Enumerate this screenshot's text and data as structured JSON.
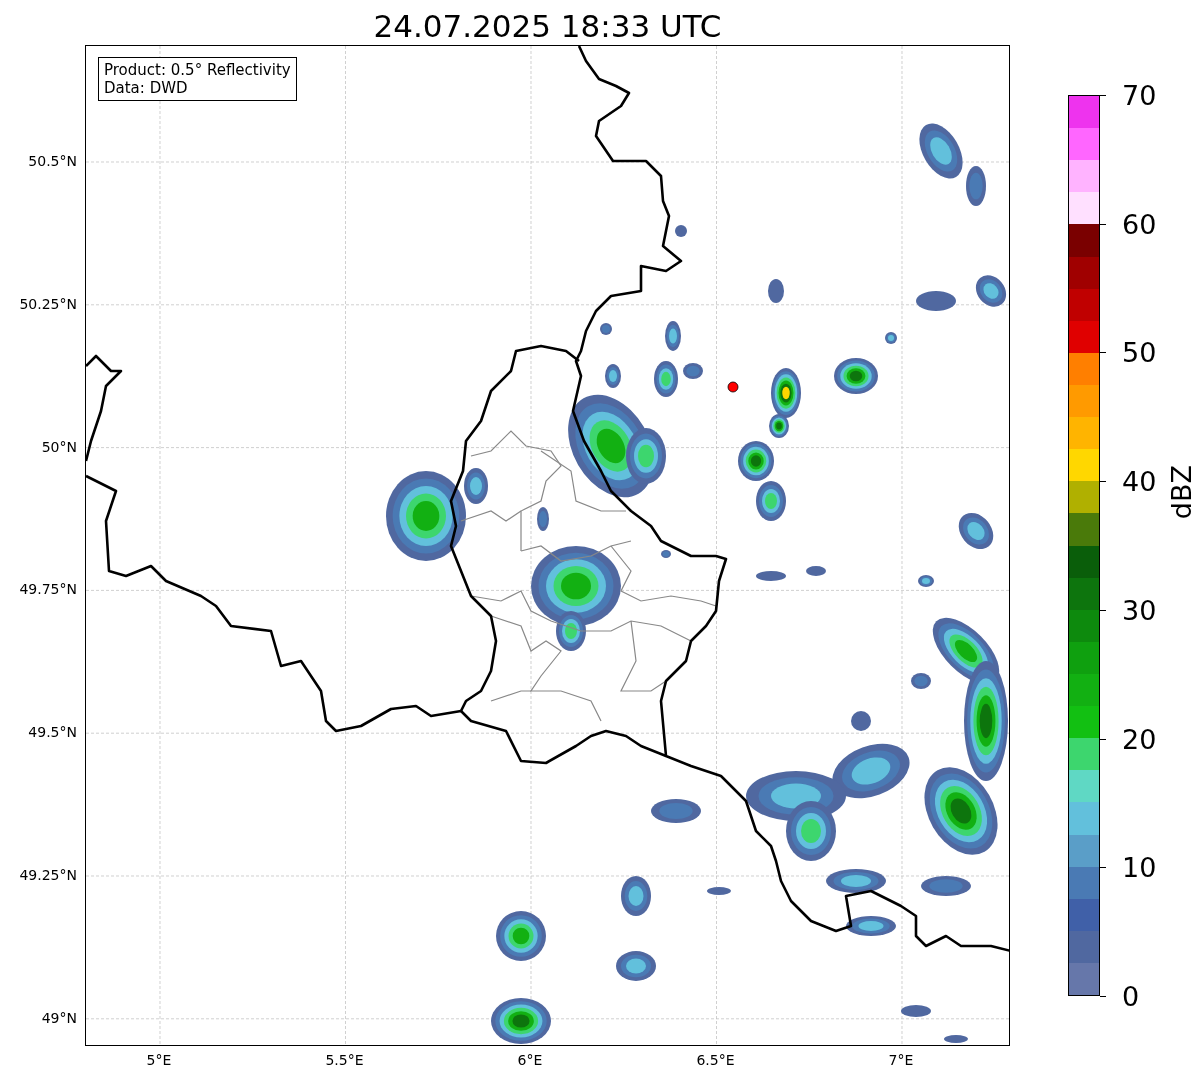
{
  "title": "24.07.2025 18:33 UTC",
  "legend": [
    "Product: 0.5° Reflectivity",
    "Data: DWD"
  ],
  "map": {
    "x_ticks": [
      "5°E",
      "5.5°E",
      "6°E",
      "6.5°E",
      "7°E"
    ],
    "y_ticks": [
      "50.5°N",
      "50.25°N",
      "50°N",
      "49.75°N",
      "49.5°N",
      "49.25°N",
      "49°N"
    ]
  },
  "colorbar": {
    "label": "dBZ",
    "ticks": [
      "70",
      "60",
      "50",
      "40",
      "30",
      "20",
      "10",
      "0"
    ],
    "bands": [
      {
        "color": "#ee33ee"
      },
      {
        "color": "#ff66ff"
      },
      {
        "color": "#ffb3ff"
      },
      {
        "color": "#ffe0ff"
      },
      {
        "color": "#7a0000"
      },
      {
        "color": "#a00000"
      },
      {
        "color": "#c00000"
      },
      {
        "color": "#e00000"
      },
      {
        "color": "#ff7f00"
      },
      {
        "color": "#ff9a00"
      },
      {
        "color": "#ffb400"
      },
      {
        "color": "#ffd700"
      },
      {
        "color": "#b0b000"
      },
      {
        "color": "#4a7a0a"
      },
      {
        "color": "#0a5e0a"
      },
      {
        "color": "#0d750d"
      },
      {
        "color": "#0d8a0d"
      },
      {
        "color": "#0fa00f"
      },
      {
        "color": "#12b012"
      },
      {
        "color": "#12c012"
      },
      {
        "color": "#3dd66e"
      },
      {
        "color": "#5fd8c4"
      },
      {
        "color": "#62c0dc"
      },
      {
        "color": "#5a9ec8"
      },
      {
        "color": "#4a7ab4"
      },
      {
        "color": "#4060a8"
      },
      {
        "color": "#5068a0"
      },
      {
        "color": "#6677aa"
      }
    ]
  }
}
